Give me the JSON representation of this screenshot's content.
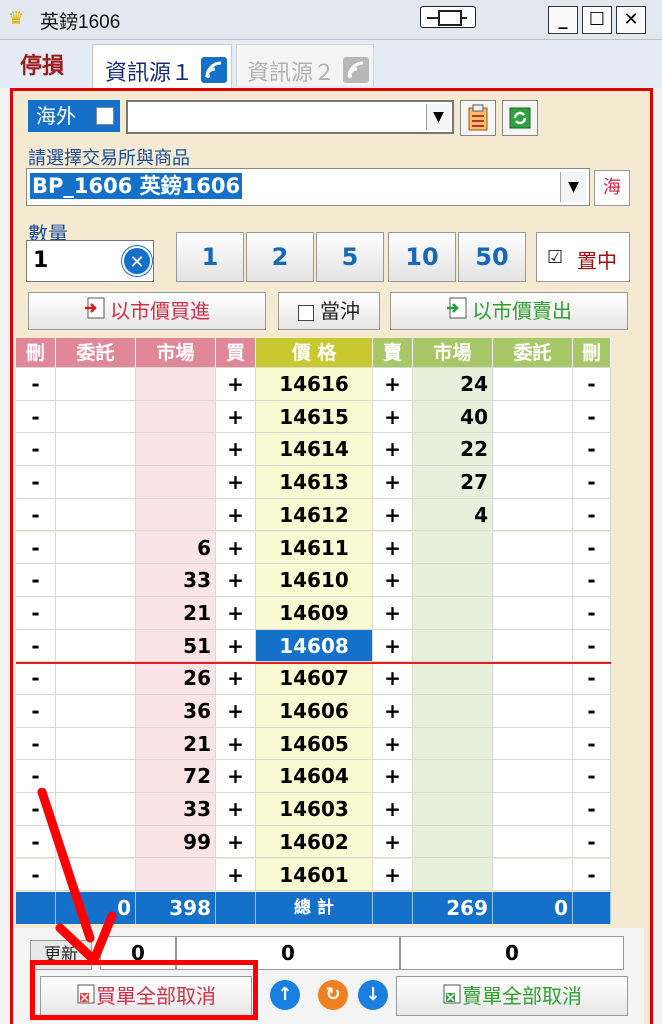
{
  "window": {
    "title": "英鎊1606"
  },
  "tabs": {
    "stop": "停損",
    "source1": "資訊源１",
    "source2": "資訊源２"
  },
  "top": {
    "overseas": "海外",
    "select_label": "請選擇交易所與商品",
    "product": "BP_1606 英鎊1606",
    "hai_button": "海",
    "qty_label": "數量",
    "qty_value": "1",
    "quick_qty": [
      "1",
      "2",
      "5",
      "10",
      "50"
    ],
    "center_label": "置中",
    "center_check": "☑"
  },
  "trade": {
    "buy_market": "以市價買進",
    "offset": "當沖",
    "sell_market": "以市價賣出"
  },
  "table": {
    "headers": [
      "刪",
      "委託",
      "市場",
      "買",
      "價 格",
      "賣",
      "市場",
      "委託",
      "刪"
    ],
    "rows": [
      {
        "del": "-",
        "bid_q": "",
        "bid": "",
        "b": "+",
        "price": "14616",
        "s": "+",
        "ask": "24",
        "ask_q": "",
        "del2": "-"
      },
      {
        "del": "-",
        "bid_q": "",
        "bid": "",
        "b": "+",
        "price": "14615",
        "s": "+",
        "ask": "40",
        "ask_q": "",
        "del2": "-"
      },
      {
        "del": "-",
        "bid_q": "",
        "bid": "",
        "b": "+",
        "price": "14614",
        "s": "+",
        "ask": "22",
        "ask_q": "",
        "del2": "-"
      },
      {
        "del": "-",
        "bid_q": "",
        "bid": "",
        "b": "+",
        "price": "14613",
        "s": "+",
        "ask": "27",
        "ask_q": "",
        "del2": "-"
      },
      {
        "del": "-",
        "bid_q": "",
        "bid": "",
        "b": "+",
        "price": "14612",
        "s": "+",
        "ask": "4",
        "ask_q": "",
        "del2": "-"
      },
      {
        "del": "-",
        "bid_q": "",
        "bid": "6",
        "b": "+",
        "price": "14611",
        "s": "+",
        "ask": "",
        "ask_q": "",
        "del2": "-"
      },
      {
        "del": "-",
        "bid_q": "",
        "bid": "33",
        "b": "+",
        "price": "14610",
        "s": "+",
        "ask": "",
        "ask_q": "",
        "del2": "-"
      },
      {
        "del": "-",
        "bid_q": "",
        "bid": "21",
        "b": "+",
        "price": "14609",
        "s": "+",
        "ask": "",
        "ask_q": "",
        "del2": "-"
      },
      {
        "del": "-",
        "bid_q": "",
        "bid": "51",
        "b": "+",
        "price": "14608",
        "s": "+",
        "ask": "",
        "ask_q": "",
        "del2": "-"
      },
      {
        "del": "-",
        "bid_q": "",
        "bid": "26",
        "b": "+",
        "price": "14607",
        "s": "+",
        "ask": "",
        "ask_q": "",
        "del2": "-"
      },
      {
        "del": "-",
        "bid_q": "",
        "bid": "36",
        "b": "+",
        "price": "14606",
        "s": "+",
        "ask": "",
        "ask_q": "",
        "del2": "-"
      },
      {
        "del": "-",
        "bid_q": "",
        "bid": "21",
        "b": "+",
        "price": "14605",
        "s": "+",
        "ask": "",
        "ask_q": "",
        "del2": "-"
      },
      {
        "del": "-",
        "bid_q": "",
        "bid": "72",
        "b": "+",
        "price": "14604",
        "s": "+",
        "ask": "",
        "ask_q": "",
        "del2": "-"
      },
      {
        "del": "-",
        "bid_q": "",
        "bid": "33",
        "b": "+",
        "price": "14603",
        "s": "+",
        "ask": "",
        "ask_q": "",
        "del2": "-"
      },
      {
        "del": "-",
        "bid_q": "",
        "bid": "99",
        "b": "+",
        "price": "14602",
        "s": "+",
        "ask": "",
        "ask_q": "",
        "del2": "-"
      },
      {
        "del": "-",
        "bid_q": "",
        "bid": "",
        "b": "+",
        "price": "14601",
        "s": "+",
        "ask": "",
        "ask_q": "",
        "del2": "-"
      }
    ],
    "current_price": "14608",
    "totals": {
      "bid_q": "0",
      "bid": "398",
      "label": "總 計",
      "ask": "269",
      "ask_q": "0"
    }
  },
  "bottom": {
    "refresh": "更新",
    "sum1": "0",
    "sum2": "0",
    "sum3": "0",
    "cancel_buy": "買單全部取消",
    "cancel_sell": "賣單全部取消"
  },
  "colors": {
    "accent": "#1470c8",
    "frame": "#e00000",
    "buy_bg": "#fbe4e8",
    "sell_bg": "#e8f0dc",
    "price_bg": "#fafad2"
  }
}
